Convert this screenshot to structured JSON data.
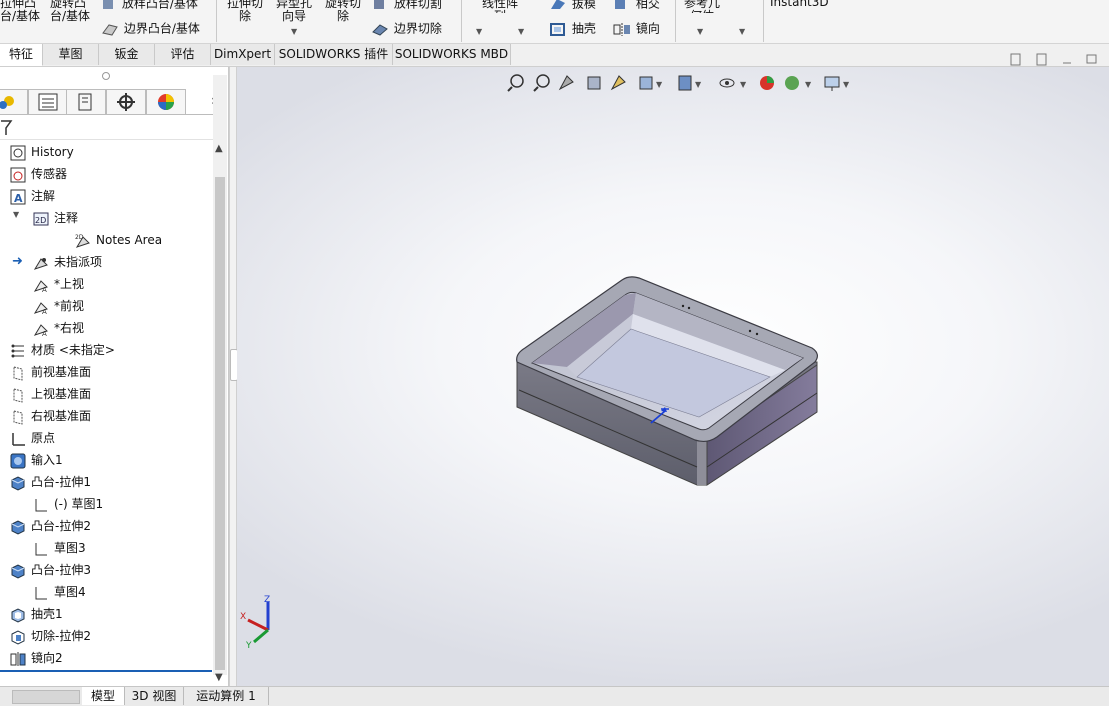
{
  "ribbon": {
    "extrude_boss": "拉伸凸\n台/基体",
    "revolve_boss": "旋转凸\n台/基体",
    "loft_boss": "放样凸台/基体",
    "boundary_boss": "边界凸台/基体",
    "extrude_cut": "拉伸切\n除",
    "hole_wizard": "异型孔\n向导",
    "revolve_cut": "旋转切\n除",
    "loft_cut": "放样切割",
    "boundary_cut": "边界切除",
    "pattern": "线性阵\n列",
    "draft": "拔模",
    "shell": "抽壳",
    "intersect": "相交",
    "mirror": "镜向",
    "ref_geometry": "参考几\n何体",
    "instant3d": "Instant3D"
  },
  "tabs": [
    "特征",
    "草图",
    "钣金",
    "评估",
    "DimXpert",
    "SOLIDWORKS 插件",
    "SOLIDWORKS MBD"
  ],
  "active_tab": "特征",
  "tree": {
    "filter_icon": "filter-icon",
    "items": [
      {
        "label": "History",
        "icon": "history-icon"
      },
      {
        "label": "传感器",
        "icon": "sensor-icon"
      },
      {
        "label": "注解",
        "icon": "annotation-icon"
      },
      {
        "label": "注释",
        "icon": "notes-2d-icon"
      },
      {
        "label": "Notes Area",
        "icon": "notes-area-icon"
      },
      {
        "label": "未指派项",
        "icon": "unassigned-icon"
      },
      {
        "label": "*上视",
        "icon": "view-icon"
      },
      {
        "label": "*前视",
        "icon": "view-icon"
      },
      {
        "label": "*右视",
        "icon": "view-icon"
      },
      {
        "label": "材质 <未指定>",
        "icon": "material-icon"
      },
      {
        "label": "前视基准面",
        "icon": "plane-icon"
      },
      {
        "label": "上视基准面",
        "icon": "plane-icon"
      },
      {
        "label": "右视基准面",
        "icon": "plane-icon"
      },
      {
        "label": "原点",
        "icon": "origin-icon"
      },
      {
        "label": "输入1",
        "icon": "import-icon"
      },
      {
        "label": "凸台-拉伸1",
        "icon": "boss-extrude-icon"
      },
      {
        "label": "(-) 草图1",
        "icon": "sketch-icon"
      },
      {
        "label": "凸台-拉伸2",
        "icon": "boss-extrude-icon"
      },
      {
        "label": "草图3",
        "icon": "sketch-icon"
      },
      {
        "label": "凸台-拉伸3",
        "icon": "boss-extrude-icon"
      },
      {
        "label": "草图4",
        "icon": "sketch-icon"
      },
      {
        "label": "抽壳1",
        "icon": "shell-icon"
      },
      {
        "label": "切除-拉伸2",
        "icon": "cut-extrude-icon"
      },
      {
        "label": "镜向2",
        "icon": "mirror-icon"
      }
    ]
  },
  "bottom_tabs": [
    "模型",
    "3D 视图",
    "运动算例 1"
  ],
  "active_bottom_tab": "模型",
  "triad": {
    "x": "X",
    "y": "Y",
    "z": "Z"
  },
  "colors": {
    "accent": "#1a5fb4",
    "part_gray": "#8f8f98",
    "part_purple": "#6e6886"
  }
}
